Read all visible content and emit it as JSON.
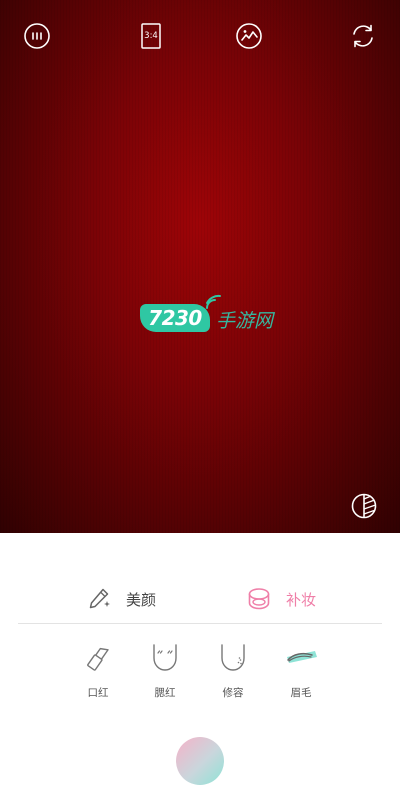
{
  "camera": {
    "top_bar": {
      "menu_icon": "menu-dots-icon",
      "ratio_label": "3:4",
      "album_icon": "image-icon",
      "flip_icon": "flip-camera-icon"
    },
    "watermark": {
      "badge": "7230",
      "text": "手游网"
    },
    "contrast_icon": "contrast-icon"
  },
  "panel": {
    "tabs": [
      {
        "label": "美颜",
        "icon": "wand-icon",
        "active": false
      },
      {
        "label": "补妆",
        "icon": "compact-icon",
        "active": true
      }
    ],
    "items": [
      {
        "label": "口红",
        "icon": "lipstick-icon"
      },
      {
        "label": "腮红",
        "icon": "blush-icon"
      },
      {
        "label": "修容",
        "icon": "contour-icon"
      },
      {
        "label": "眉毛",
        "icon": "eyebrow-icon"
      }
    ],
    "shutter_icon": "shutter-icon"
  },
  "colors": {
    "accent_pink": "#ef7fa8",
    "accent_teal": "#8ee3d6",
    "watermark_green": "#2fc7a3"
  }
}
